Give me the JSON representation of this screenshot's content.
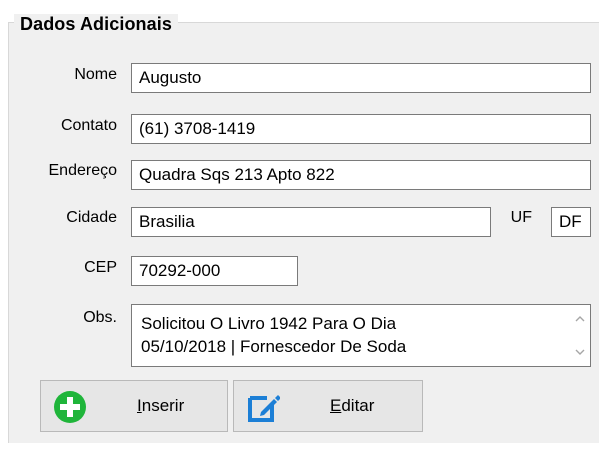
{
  "group": {
    "title": "Dados Adicionais"
  },
  "fields": {
    "nome": {
      "label": "Nome",
      "value": "Augusto"
    },
    "contato": {
      "label": "Contato",
      "value": "(61) 3708-1419"
    },
    "endereco": {
      "label": "Endereço",
      "value": "Quadra Sqs 213 Apto 822"
    },
    "cidade": {
      "label": "Cidade",
      "value": "Brasilia"
    },
    "uf": {
      "label": "UF",
      "value": "DF"
    },
    "cep": {
      "label": "CEP",
      "value": "70292-000"
    },
    "obs": {
      "label": "Obs.",
      "lines": [
        "Solicitou O Livro 1942 Para O Dia",
        "05/10/2018 | Fornescedor De Soda"
      ]
    }
  },
  "buttons": {
    "inserir": {
      "accel": "I",
      "rest": "nserir",
      "icon": "plus-circle-icon"
    },
    "editar": {
      "accel": "E",
      "rest": "ditar",
      "icon": "edit-icon"
    }
  },
  "colors": {
    "insert_icon": "#1fb53a",
    "edit_icon": "#1c7fd6"
  }
}
